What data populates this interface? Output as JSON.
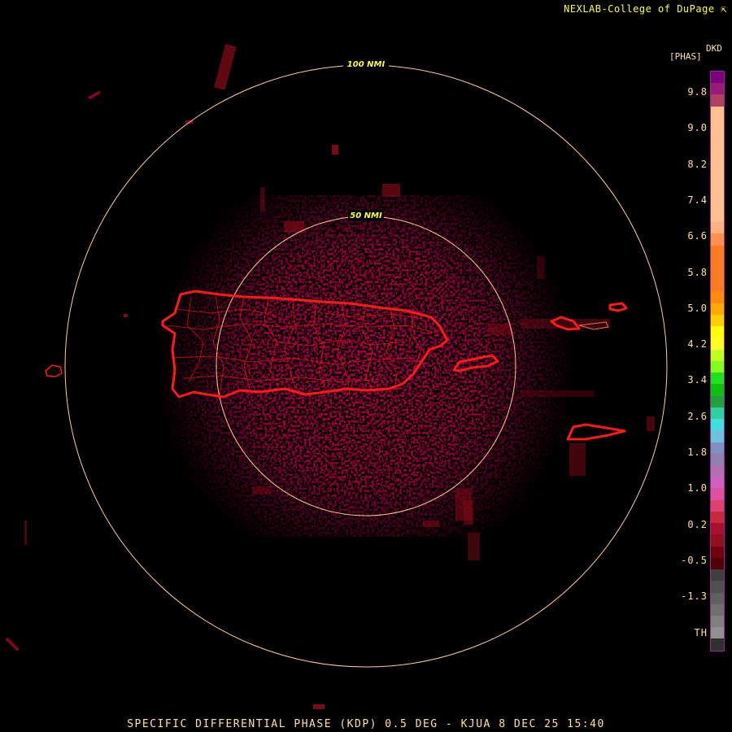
{
  "header": {
    "credit": "NEXLAB-College of DuPage",
    "credit_icon": "arrow-icon"
  },
  "footer": {
    "product": "SPECIFIC DIFFERENTIAL PHASE (KDP) 0.5 DEG - KJUA 8 DEC 25 15:40"
  },
  "range_rings": [
    {
      "label": "50 NMI",
      "radius_nmi": 50
    },
    {
      "label": "100 NMI",
      "radius_nmi": 100
    }
  ],
  "colors": {
    "ring": "#ffcc99",
    "coastline": "#ff1a1a",
    "ring_label": "#ffff33",
    "echo": "#6a0010"
  },
  "legend": {
    "name": "DKD",
    "unit": "[PHAS]",
    "ticks": [
      "9.8",
      "9.0",
      "8.2",
      "7.4",
      "6.6",
      "5.8",
      "5.0",
      "4.2",
      "3.4",
      "2.6",
      "1.8",
      "1.0",
      "0.2",
      "-0.5",
      "-1.3",
      "TH"
    ],
    "colors": [
      "#7a007a",
      "#9a1a7a",
      "#b04060",
      "#ffc090",
      "#ffc090",
      "#ffc090",
      "#ffc090",
      "#ffc090",
      "#ffc090",
      "#ffc090",
      "#ffc090",
      "#ffc090",
      "#ffc090",
      "#ffb080",
      "#ff9050",
      "#ff7a20",
      "#ff7a20",
      "#ff7a20",
      "#ff7a20",
      "#ff8a10",
      "#ffaa00",
      "#ffd000",
      "#ffff00",
      "#ffff20",
      "#c0ff20",
      "#80ff20",
      "#20e020",
      "#10c010",
      "#20a040",
      "#30d0a0",
      "#40e0e0",
      "#70c0e0",
      "#8090c0",
      "#9080b0",
      "#b070b0",
      "#d060c0",
      "#e050a0",
      "#e04070",
      "#c82840",
      "#a81030",
      "#901020",
      "#700010",
      "#500008",
      "#404040",
      "#505050",
      "#606060",
      "#707070",
      "#808080",
      "#909090",
      "#303030"
    ]
  }
}
